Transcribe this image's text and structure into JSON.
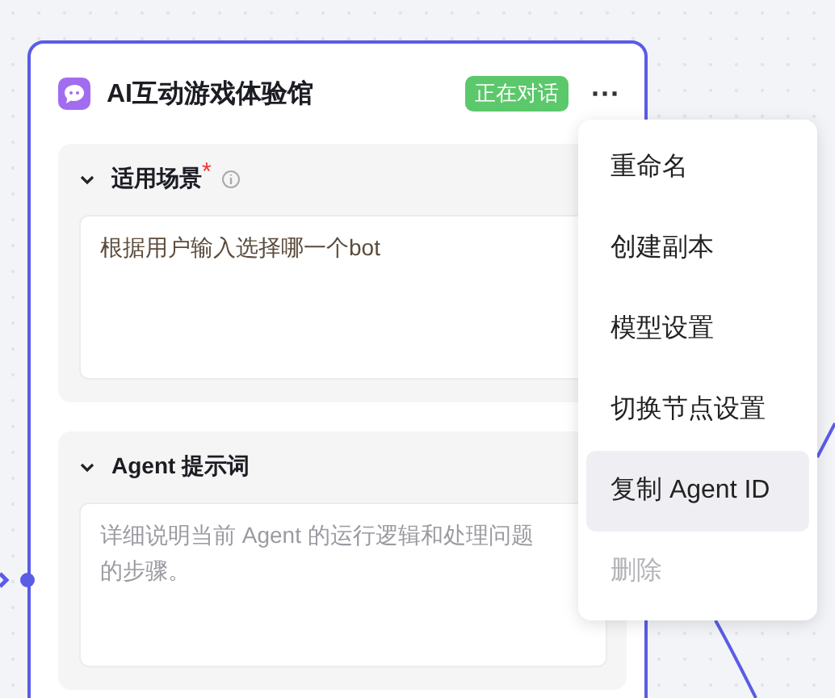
{
  "node": {
    "title": "AI互动游戏体验馆",
    "status": "正在对话",
    "more": "···",
    "sections": [
      {
        "title": "适用场景",
        "required_mark": "*",
        "info": true,
        "expanded": true,
        "value": "根据用户输入选择哪一个bot"
      },
      {
        "title": "Agent 提示词",
        "expanded": true,
        "placeholder": "详细说明当前 Agent 的运行逻辑和处理问题的步骤。"
      }
    ]
  },
  "menu": {
    "items": [
      {
        "label": "重命名",
        "highlighted": false,
        "disabled": false
      },
      {
        "label": "创建副本",
        "highlighted": false,
        "disabled": false
      },
      {
        "label": "模型设置",
        "highlighted": false,
        "disabled": false
      },
      {
        "label": "切换节点设置",
        "highlighted": false,
        "disabled": false
      },
      {
        "label": "复制 Agent ID",
        "highlighted": true,
        "disabled": false
      },
      {
        "label": "删除",
        "highlighted": false,
        "disabled": true
      }
    ]
  }
}
